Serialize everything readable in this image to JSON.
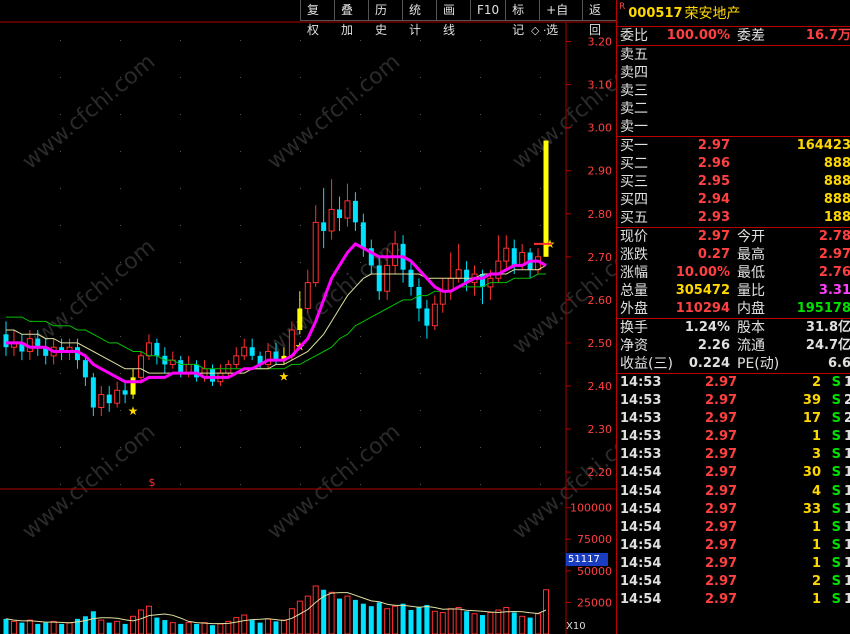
{
  "toolbar": [
    "复权",
    "叠加",
    "历史",
    "统计",
    "画线",
    "F10",
    "标记",
    "+自选",
    "返回"
  ],
  "price_axis": [
    "3.20",
    "3.10",
    "3.00",
    "2.90",
    "2.80",
    "2.70",
    "2.60",
    "2.50",
    "2.40",
    "2.30",
    "2.20"
  ],
  "volume_axis": [
    "100000",
    "75000",
    "50000",
    "25000"
  ],
  "volume_marker": "51117",
  "volume_unit": "X10",
  "special_marker": "$",
  "watermark": "www.cfchi.com",
  "colors": {
    "up": "#ff3030",
    "down": "#00e0ff",
    "limit": "#ffff00",
    "ma5": "#ff00ff",
    "panel_border": "#b00000"
  },
  "stock": {
    "badge": "R",
    "code": "000517",
    "name": "荣安地产"
  },
  "ratio": {
    "label": "委比",
    "value": "100.00%",
    "label2": "委差",
    "value2": "16.7万"
  },
  "asks": [
    {
      "label": "卖五"
    },
    {
      "label": "卖四"
    },
    {
      "label": "卖三"
    },
    {
      "label": "卖二"
    },
    {
      "label": "卖一"
    }
  ],
  "bids": [
    {
      "label": "买一",
      "price": "2.97",
      "vol": "164423"
    },
    {
      "label": "买二",
      "price": "2.96",
      "vol": "888"
    },
    {
      "label": "买三",
      "price": "2.95",
      "vol": "888"
    },
    {
      "label": "买四",
      "price": "2.94",
      "vol": "888"
    },
    {
      "label": "买五",
      "price": "2.93",
      "vol": "188"
    }
  ],
  "quote": [
    {
      "l1": "现价",
      "v1": "2.97",
      "l2": "今开",
      "v2": "2.78"
    },
    {
      "l1": "涨跌",
      "v1": "0.27",
      "l2": "最高",
      "v2": "2.97"
    },
    {
      "l1": "涨幅",
      "v1": "10.00%",
      "l2": "最低",
      "v2": "2.76"
    },
    {
      "l1": "总量",
      "v1": "305472",
      "l2": "量比",
      "v2": "3.31"
    },
    {
      "l1": "外盘",
      "v1": "110294",
      "l2": "内盘",
      "v2": "195178"
    }
  ],
  "stats": [
    {
      "l1": "换手",
      "v1": "1.24%",
      "l2": "股本",
      "v2": "31.8亿"
    },
    {
      "l1": "净资",
      "v1": "2.26",
      "l2": "流通",
      "v2": "24.7亿"
    },
    {
      "l1": "收益(三)",
      "v1": "0.224",
      "l2": "PE(动)",
      "v2": "6.6"
    }
  ],
  "ticks": [
    {
      "time": "14:53",
      "price": "2.97",
      "qty": "2",
      "side": "S",
      "n": "1"
    },
    {
      "time": "14:53",
      "price": "2.97",
      "qty": "39",
      "side": "S",
      "n": "2"
    },
    {
      "time": "14:53",
      "price": "2.97",
      "qty": "17",
      "side": "S",
      "n": "2"
    },
    {
      "time": "14:53",
      "price": "2.97",
      "qty": "1",
      "side": "S",
      "n": "1"
    },
    {
      "time": "14:53",
      "price": "2.97",
      "qty": "3",
      "side": "S",
      "n": "1"
    },
    {
      "time": "14:54",
      "price": "2.97",
      "qty": "30",
      "side": "S",
      "n": "1"
    },
    {
      "time": "14:54",
      "price": "2.97",
      "qty": "4",
      "side": "S",
      "n": "1"
    },
    {
      "time": "14:54",
      "price": "2.97",
      "qty": "33",
      "side": "S",
      "n": "1"
    },
    {
      "time": "14:54",
      "price": "2.97",
      "qty": "1",
      "side": "S",
      "n": "1"
    },
    {
      "time": "14:54",
      "price": "2.97",
      "qty": "1",
      "side": "S",
      "n": "1"
    },
    {
      "time": "14:54",
      "price": "2.97",
      "qty": "1",
      "side": "S",
      "n": "1"
    },
    {
      "time": "14:54",
      "price": "2.97",
      "qty": "2",
      "side": "S",
      "n": "1"
    },
    {
      "time": "14:54",
      "price": "2.97",
      "qty": "1",
      "side": "S",
      "n": "1"
    }
  ],
  "chart_data": {
    "type": "candlestick",
    "ylim": [
      2.17,
      3.25
    ],
    "candles": [
      [
        2.52,
        2.49,
        2.55,
        2.47
      ],
      [
        2.49,
        2.5,
        2.53,
        2.47
      ],
      [
        2.5,
        2.48,
        2.52,
        2.46
      ],
      [
        2.48,
        2.51,
        2.53,
        2.46
      ],
      [
        2.51,
        2.49,
        2.53,
        2.47
      ],
      [
        2.49,
        2.47,
        2.51,
        2.45
      ],
      [
        2.47,
        2.49,
        2.51,
        2.45
      ],
      [
        2.49,
        2.48,
        2.51,
        2.46
      ],
      [
        2.48,
        2.49,
        2.51,
        2.46
      ],
      [
        2.49,
        2.46,
        2.51,
        2.44
      ],
      [
        2.46,
        2.42,
        2.47,
        2.4
      ],
      [
        2.42,
        2.35,
        2.43,
        2.33
      ],
      [
        2.35,
        2.38,
        2.4,
        2.33
      ],
      [
        2.38,
        2.36,
        2.4,
        2.34
      ],
      [
        2.36,
        2.39,
        2.41,
        2.35
      ],
      [
        2.39,
        2.38,
        2.41,
        2.36
      ],
      [
        2.38,
        2.42,
        2.44,
        2.37
      ],
      [
        2.42,
        2.47,
        2.48,
        2.41
      ],
      [
        2.47,
        2.5,
        2.52,
        2.46
      ],
      [
        2.5,
        2.47,
        2.51,
        2.45
      ],
      [
        2.47,
        2.45,
        2.49,
        2.43
      ],
      [
        2.45,
        2.46,
        2.48,
        2.44
      ],
      [
        2.46,
        2.43,
        2.47,
        2.42
      ],
      [
        2.43,
        2.45,
        2.47,
        2.42
      ],
      [
        2.45,
        2.42,
        2.46,
        2.41
      ],
      [
        2.42,
        2.44,
        2.46,
        2.41
      ],
      [
        2.44,
        2.41,
        2.45,
        2.4
      ],
      [
        2.41,
        2.43,
        2.45,
        2.4
      ],
      [
        2.43,
        2.45,
        2.46,
        2.42
      ],
      [
        2.45,
        2.47,
        2.49,
        2.44
      ],
      [
        2.47,
        2.49,
        2.51,
        2.46
      ],
      [
        2.49,
        2.47,
        2.51,
        2.46
      ],
      [
        2.47,
        2.45,
        2.48,
        2.44
      ],
      [
        2.45,
        2.48,
        2.5,
        2.44
      ],
      [
        2.48,
        2.46,
        2.5,
        2.45
      ],
      [
        2.46,
        2.47,
        2.49,
        2.45
      ],
      [
        2.47,
        2.53,
        2.55,
        2.46
      ],
      [
        2.53,
        2.58,
        2.62,
        2.52
      ],
      [
        2.58,
        2.64,
        2.67,
        2.57
      ],
      [
        2.64,
        2.78,
        2.82,
        2.63
      ],
      [
        2.78,
        2.76,
        2.86,
        2.72
      ],
      [
        2.76,
        2.81,
        2.88,
        2.74
      ],
      [
        2.81,
        2.79,
        2.84,
        2.76
      ],
      [
        2.79,
        2.83,
        2.87,
        2.77
      ],
      [
        2.83,
        2.78,
        2.85,
        2.76
      ],
      [
        2.78,
        2.72,
        2.8,
        2.7
      ],
      [
        2.72,
        2.68,
        2.74,
        2.66
      ],
      [
        2.68,
        2.62,
        2.7,
        2.6
      ],
      [
        2.62,
        2.68,
        2.72,
        2.6
      ],
      [
        2.68,
        2.73,
        2.76,
        2.66
      ],
      [
        2.73,
        2.67,
        2.75,
        2.64
      ],
      [
        2.67,
        2.63,
        2.69,
        2.61
      ],
      [
        2.63,
        2.58,
        2.65,
        2.55
      ],
      [
        2.58,
        2.54,
        2.6,
        2.51
      ],
      [
        2.54,
        2.59,
        2.61,
        2.53
      ],
      [
        2.59,
        2.62,
        2.65,
        2.57
      ],
      [
        2.62,
        2.65,
        2.71,
        2.6
      ],
      [
        2.65,
        2.67,
        2.73,
        2.64
      ],
      [
        2.67,
        2.64,
        2.69,
        2.62
      ],
      [
        2.64,
        2.66,
        2.68,
        2.61
      ],
      [
        2.66,
        2.63,
        2.67,
        2.59
      ],
      [
        2.63,
        2.65,
        2.67,
        2.6
      ],
      [
        2.65,
        2.69,
        2.75,
        2.64
      ],
      [
        2.69,
        2.72,
        2.75,
        2.67
      ],
      [
        2.72,
        2.68,
        2.74,
        2.66
      ],
      [
        2.68,
        2.71,
        2.73,
        2.67
      ],
      [
        2.71,
        2.67,
        2.72,
        2.65
      ],
      [
        2.67,
        2.7,
        2.72,
        2.66
      ],
      [
        2.7,
        2.97,
        2.97,
        2.76
      ]
    ],
    "limit_up": [
      16,
      35,
      37,
      68
    ],
    "ma5": [
      2.5,
      2.5,
      2.5,
      2.49,
      2.49,
      2.49,
      2.48,
      2.48,
      2.48,
      2.48,
      2.47,
      2.45,
      2.44,
      2.43,
      2.42,
      2.41,
      2.41,
      2.41,
      2.42,
      2.42,
      2.42,
      2.43,
      2.43,
      2.43,
      2.43,
      2.42,
      2.42,
      2.42,
      2.42,
      2.43,
      2.44,
      2.44,
      2.45,
      2.46,
      2.46,
      2.46,
      2.47,
      2.49,
      2.51,
      2.55,
      2.6,
      2.65,
      2.68,
      2.71,
      2.73,
      2.72,
      2.71,
      2.7,
      2.7,
      2.7,
      2.7,
      2.69,
      2.67,
      2.65,
      2.63,
      2.62,
      2.62,
      2.63,
      2.64,
      2.65,
      2.65,
      2.66,
      2.66,
      2.67,
      2.68,
      2.68,
      2.69,
      2.69,
      2.68
    ],
    "ma10": [
      2.53,
      2.53,
      2.52,
      2.52,
      2.52,
      2.51,
      2.51,
      2.5,
      2.5,
      2.5,
      2.49,
      2.48,
      2.47,
      2.46,
      2.45,
      2.44,
      2.44,
      2.44,
      2.43,
      2.43,
      2.43,
      2.43,
      2.43,
      2.43,
      2.43,
      2.43,
      2.43,
      2.43,
      2.43,
      2.43,
      2.43,
      2.44,
      2.44,
      2.44,
      2.45,
      2.45,
      2.46,
      2.47,
      2.48,
      2.5,
      2.52,
      2.55,
      2.58,
      2.61,
      2.63,
      2.65,
      2.66,
      2.66,
      2.66,
      2.66,
      2.66,
      2.66,
      2.66,
      2.65,
      2.65,
      2.65,
      2.65,
      2.65,
      2.65,
      2.65,
      2.66,
      2.66,
      2.66,
      2.66,
      2.67,
      2.67,
      2.67,
      2.67,
      2.68
    ],
    "ma20": [
      2.56,
      2.56,
      2.56,
      2.55,
      2.55,
      2.55,
      2.54,
      2.54,
      2.54,
      2.53,
      2.53,
      2.52,
      2.51,
      2.5,
      2.5,
      2.49,
      2.48,
      2.48,
      2.47,
      2.47,
      2.46,
      2.46,
      2.45,
      2.45,
      2.45,
      2.44,
      2.44,
      2.44,
      2.44,
      2.44,
      2.44,
      2.44,
      2.44,
      2.44,
      2.44,
      2.44,
      2.45,
      2.45,
      2.46,
      2.47,
      2.48,
      2.49,
      2.51,
      2.52,
      2.54,
      2.55,
      2.56,
      2.57,
      2.58,
      2.59,
      2.6,
      2.6,
      2.61,
      2.61,
      2.62,
      2.62,
      2.62,
      2.63,
      2.63,
      2.63,
      2.63,
      2.64,
      2.64,
      2.64,
      2.65,
      2.65,
      2.65,
      2.66,
      2.66
    ],
    "volumes": [
      12,
      10,
      9,
      11,
      8,
      9,
      10,
      8,
      9,
      12,
      14,
      18,
      11,
      9,
      10,
      8,
      14,
      19,
      22,
      13,
      11,
      9,
      8,
      9,
      8,
      9,
      7,
      8,
      10,
      13,
      15,
      11,
      9,
      12,
      10,
      11,
      20,
      26,
      30,
      38,
      35,
      33,
      28,
      30,
      27,
      24,
      22,
      25,
      20,
      22,
      24,
      19,
      21,
      23,
      18,
      17,
      20,
      21,
      18,
      16,
      15,
      17,
      19,
      21,
      17,
      14,
      13,
      16,
      35
    ]
  }
}
